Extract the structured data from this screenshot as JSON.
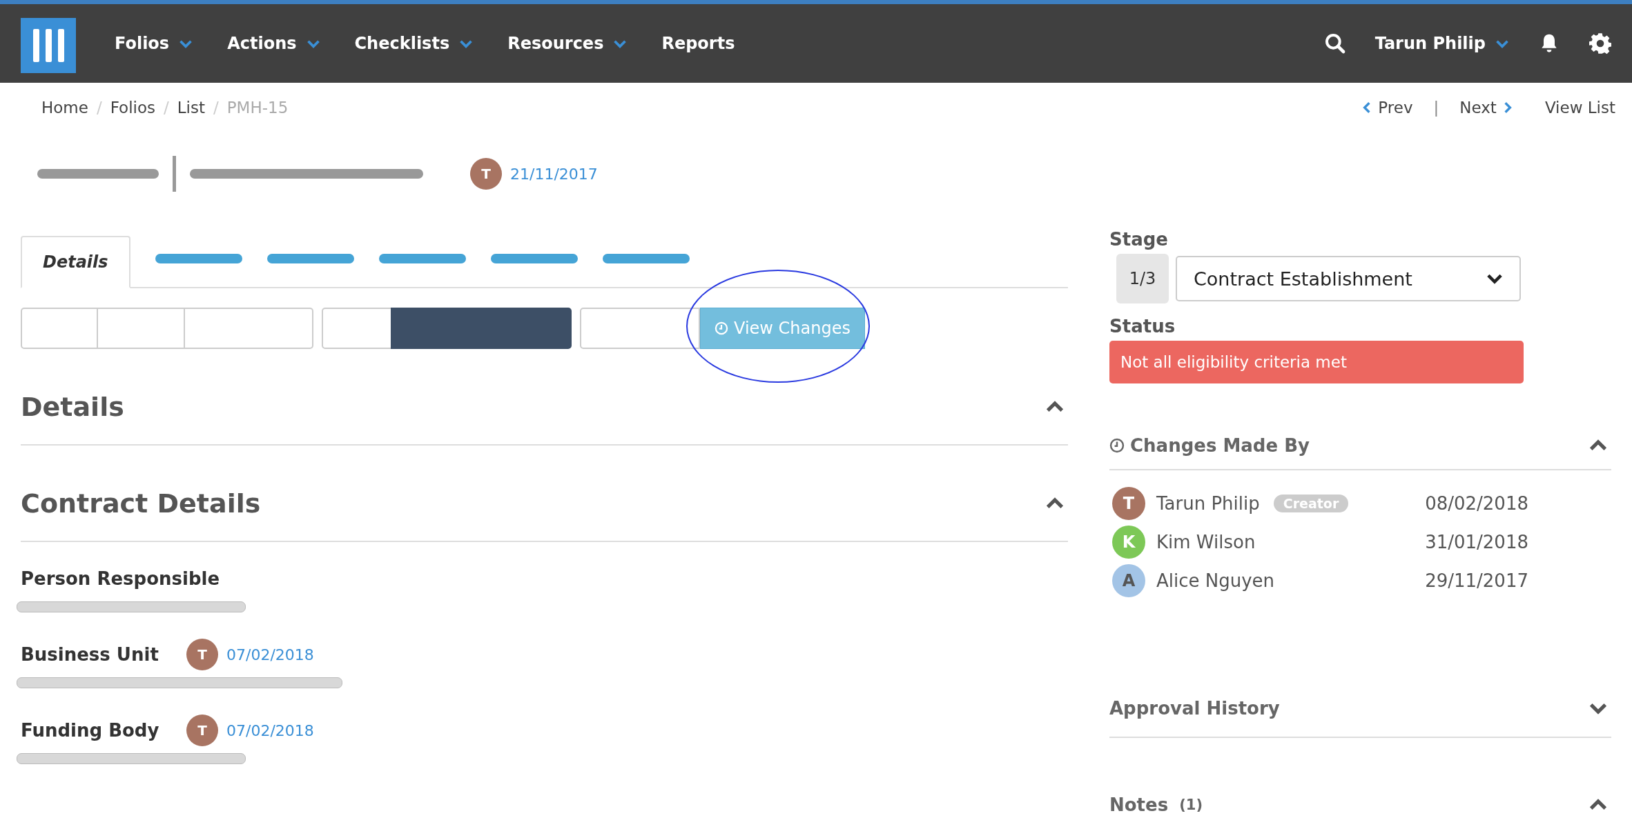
{
  "nav": {
    "items": [
      {
        "label": "Folios",
        "dropdown": true
      },
      {
        "label": "Actions",
        "dropdown": true
      },
      {
        "label": "Checklists",
        "dropdown": true
      },
      {
        "label": "Resources",
        "dropdown": true
      },
      {
        "label": "Reports",
        "dropdown": false
      }
    ],
    "user": "Tarun Philip"
  },
  "breadcrumb": {
    "items": [
      {
        "label": "Home",
        "current": false
      },
      {
        "label": "Folios",
        "current": false
      },
      {
        "label": "List",
        "current": false
      },
      {
        "label": "PMH-15",
        "current": true
      }
    ],
    "separator": "/",
    "divider": "|",
    "prev": "Prev",
    "next": "Next",
    "view_list": "View List"
  },
  "header": {
    "avatar": {
      "initial": "T",
      "color": "#a87462"
    },
    "date": "21/11/2017"
  },
  "tabs": [
    {
      "label": "Details",
      "selected": true
    },
    {
      "selected": false
    },
    {
      "selected": false
    },
    {
      "selected": false
    },
    {
      "selected": false
    },
    {
      "selected": false
    }
  ],
  "button_groups": [
    {
      "segments": [
        {
          "selected": false
        },
        {
          "selected": false
        },
        {
          "selected": false
        }
      ]
    },
    {
      "segments": [
        {
          "selected": false
        },
        {
          "selected": true
        }
      ]
    },
    {
      "segments": [
        {
          "selected": false
        }
      ]
    }
  ],
  "view_changes": {
    "label": "View Changes",
    "highlighted": true
  },
  "sections": [
    {
      "title": "Details",
      "expanded": true
    },
    {
      "title": "Contract Details",
      "expanded": true
    }
  ],
  "fields": [
    {
      "label": "Person Responsible"
    },
    {
      "label": "Business Unit",
      "avatar": {
        "initial": "T",
        "color": "#a87462"
      },
      "date": "07/02/2018"
    },
    {
      "label": "Funding Body",
      "avatar": {
        "initial": "T",
        "color": "#a87462"
      },
      "date": "07/02/2018"
    }
  ],
  "stage": {
    "label": "Stage",
    "step": "1/3",
    "value": "Contract Establishment"
  },
  "status": {
    "label": "Status",
    "value": "Not all eligibility criteria met"
  },
  "changes": {
    "title": "Changes Made By",
    "expanded": true,
    "people": [
      {
        "initial": "T",
        "color": "#a87462",
        "name": "Tarun Philip",
        "badge": "Creator",
        "date": "08/02/2018"
      },
      {
        "initial": "K",
        "color": "#7dc857",
        "name": "Kim Wilson",
        "date": "31/01/2018"
      },
      {
        "initial": "A",
        "color": "#a3c4e6",
        "name": "Alice Nguyen",
        "date": "29/11/2017"
      }
    ]
  },
  "side_sections": [
    {
      "title": "Approval History",
      "expanded": false
    },
    {
      "title": "Notes",
      "count": "(1)",
      "expanded": true
    }
  ]
}
